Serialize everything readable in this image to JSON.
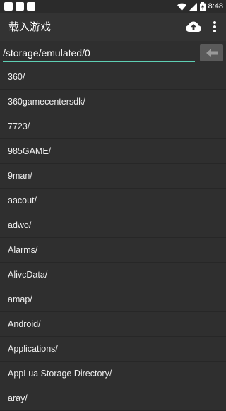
{
  "status_bar": {
    "time": "8:48",
    "icons": [
      "wifi-icon",
      "signal-icon",
      "battery-charging-icon"
    ]
  },
  "app_bar": {
    "title": "载入游戏",
    "upload_icon": "cloud-upload-icon",
    "menu_icon": "more-vert-icon"
  },
  "path_bar": {
    "current_path": "/storage/emulated/0",
    "back_icon": "arrow-left-icon"
  },
  "directory_list": [
    "360/",
    "360gamecentersdk/",
    "7723/",
    "985GAME/",
    "9man/",
    "aacout/",
    "adwo/",
    "Alarms/",
    "AlivcData/",
    "amap/",
    "Android/",
    "Applications/",
    "AppLua Storage Directory/",
    "aray/"
  ],
  "colors": {
    "background": "#2f2f2f",
    "app_bar": "#333333",
    "accent_underline": "#5ecfb4",
    "back_button": "#5a5a5a",
    "text": "#ffffff"
  }
}
